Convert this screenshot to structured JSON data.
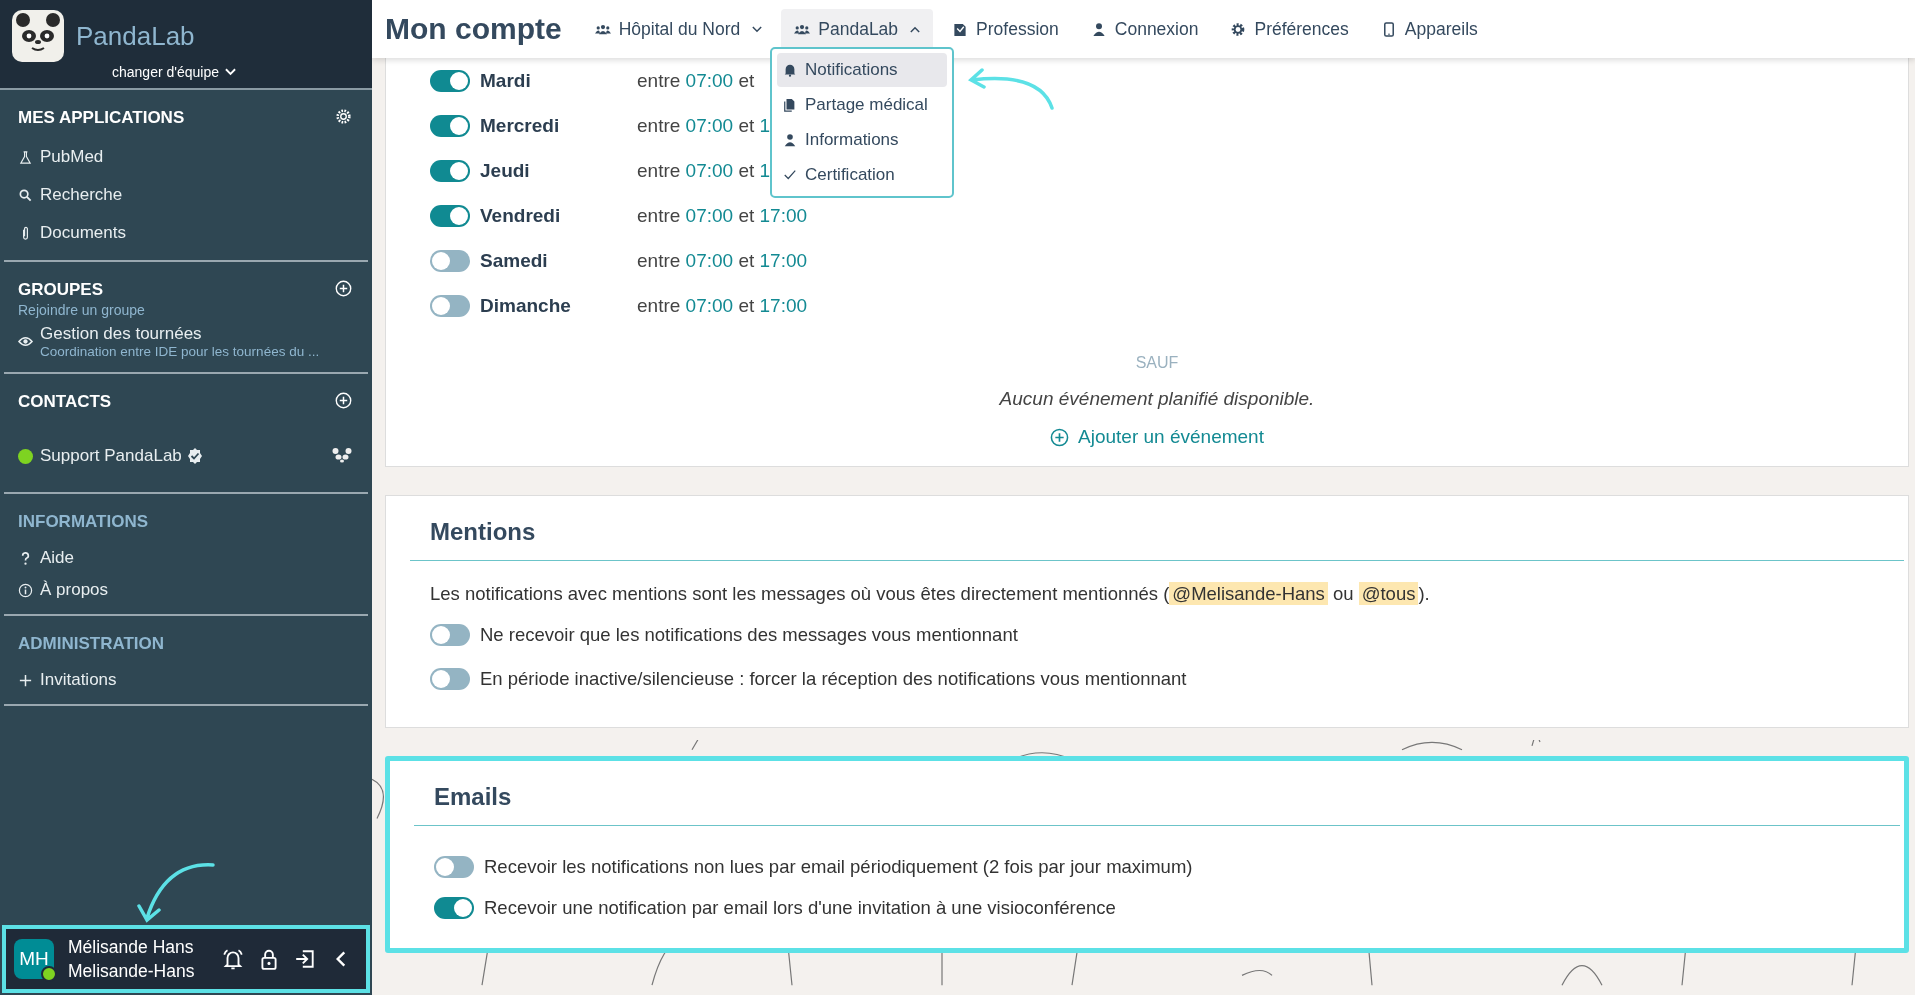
{
  "sidebar": {
    "brand": "PandaLab",
    "team_switch": "changer d'équipe",
    "sections": [
      {
        "title": "MES APPLICATIONS",
        "dim": false,
        "items": [
          {
            "label": "PubMed"
          },
          {
            "label": "Recherche"
          },
          {
            "label": "Documents"
          }
        ]
      },
      {
        "title": "GROUPES",
        "subtitle": "Rejoindre un groupe",
        "dim": false,
        "items": [
          {
            "label": "Gestion des tournées",
            "description": "Coordination entre IDE pour les tournées du ..."
          }
        ]
      },
      {
        "title": "CONTACTS",
        "dim": false,
        "items": [
          {
            "label": "Support PandaLab",
            "color": "#7ed321",
            "verified": true
          }
        ]
      },
      {
        "title": "INFORMATIONS",
        "dim": true,
        "items": [
          {
            "label": "Aide"
          },
          {
            "label": "À propos"
          }
        ]
      },
      {
        "title": "ADMINISTRATION",
        "dim": true,
        "items": [
          {
            "label": "Invitations"
          }
        ]
      }
    ],
    "user": {
      "initials": "MH",
      "name": "Mélisande Hans",
      "handle": "Melisande-Hans",
      "online": true,
      "highlighted": true
    }
  },
  "header": {
    "title": "Mon compte",
    "tabs": [
      {
        "label": "Hôpital du Nord",
        "kind": "dropdown",
        "expanded": false,
        "selected": false
      },
      {
        "label": "PandaLab",
        "kind": "dropdown",
        "expanded": true,
        "selected": true
      },
      {
        "label": "Profession",
        "kind": "link",
        "selected": false
      },
      {
        "label": "Connexion",
        "kind": "link",
        "selected": false
      },
      {
        "label": "Préférences",
        "kind": "link",
        "selected": false
      },
      {
        "label": "Appareils",
        "kind": "link",
        "selected": false
      }
    ],
    "menu": [
      {
        "label": "Notifications",
        "selected": true
      },
      {
        "label": "Partage médical",
        "selected": false
      },
      {
        "label": "Informations",
        "selected": false
      },
      {
        "label": "Certification",
        "selected": false
      }
    ]
  },
  "schedule": {
    "days": [
      {
        "label": "Mardi",
        "on": true,
        "between": "entre",
        "start": "07:00",
        "and": "et"
      },
      {
        "label": "Mercredi",
        "on": true,
        "between": "entre",
        "start": "07:00",
        "and": "et",
        "end": "1"
      },
      {
        "label": "Jeudi",
        "on": true,
        "between": "entre",
        "start": "07:00",
        "and": "et",
        "end": "1"
      },
      {
        "label": "Vendredi",
        "on": true,
        "between": "entre",
        "start": "07:00",
        "and": "et",
        "end": "17:00"
      },
      {
        "label": "Samedi",
        "on": false,
        "between": "entre",
        "start": "07:00",
        "and": "et",
        "end": "17:00"
      },
      {
        "label": "Dimanche",
        "on": false,
        "between": "entre",
        "start": "07:00",
        "and": "et",
        "end": "17:00"
      }
    ],
    "except_label": "SAUF",
    "empty_message": "Aucun événement planifié disponible.",
    "add_event": "Ajouter un événement"
  },
  "mentions": {
    "title": "Mentions",
    "intro_before": "Les notifications avec mentions sont les messages où vous êtes directement mentionnés (",
    "tags": [
      "@Melisande-Hans",
      "@tous"
    ],
    "intro_between": "ou",
    "intro_after": ").",
    "options": [
      {
        "label": "Ne recevoir que les notifications des messages vous mentionnant",
        "on": false
      },
      {
        "label": "En période inactive/silencieuse : forcer la réception des notifications vous mentionnant",
        "on": false
      }
    ]
  },
  "emails": {
    "title": "Emails",
    "highlighted": true,
    "options": [
      {
        "label": "Recevoir les notifications non lues par email périodiquement (2 fois par jour maximum)",
        "on": false
      },
      {
        "label": "Recevoir une notification par email lors d'une invitation à une visioconférence",
        "on": true
      }
    ]
  }
}
